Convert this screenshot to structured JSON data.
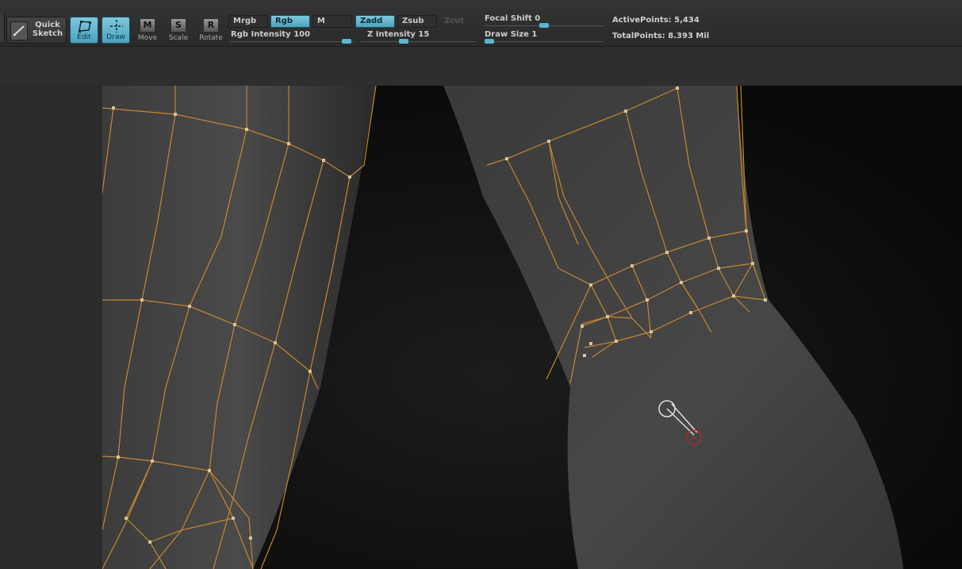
{
  "toolbar": {
    "quick_sketch": "Quick Sketch",
    "tools": [
      {
        "label": "Edit",
        "active": true
      },
      {
        "label": "Draw",
        "active": true
      },
      {
        "label": "Move",
        "glyph": "M",
        "active": false
      },
      {
        "label": "Scale",
        "glyph": "S",
        "active": false
      },
      {
        "label": "Rotate",
        "glyph": "R",
        "active": false
      }
    ],
    "mode_row1": [
      "Mrgb",
      "Rgb",
      "M"
    ],
    "mode_row2": [
      "Zadd",
      "Zsub",
      "Zcut"
    ],
    "rgb_intensity": {
      "label": "Rgb  Intensity",
      "value": "100",
      "fraction": 1.0
    },
    "z_intensity": {
      "label": "Z  Intensity",
      "value": "15",
      "fraction": 0.15
    },
    "focal_shift": {
      "label": "Focal  Shift",
      "value": "0",
      "fraction": 0.5
    },
    "draw_size": {
      "label": "Draw  Size",
      "value": "1",
      "fraction": 0.0
    },
    "active_points": {
      "label": "ActivePoints:",
      "value": "5,434"
    },
    "total_points": {
      "label": "TotalPoints:",
      "value": "8.393  Mil"
    }
  },
  "colors": {
    "accent": "#4aa3bd",
    "wire": "#c8862e",
    "mesh": "#4a4a4a",
    "background": "#0d0d0d",
    "brush_cursor": "#cc2222"
  },
  "icons": [
    "quick-sketch-icon",
    "edit-icon",
    "draw-icon",
    "move-icon",
    "scale-icon",
    "rotate-icon",
    "brush-cursor-icon"
  ]
}
